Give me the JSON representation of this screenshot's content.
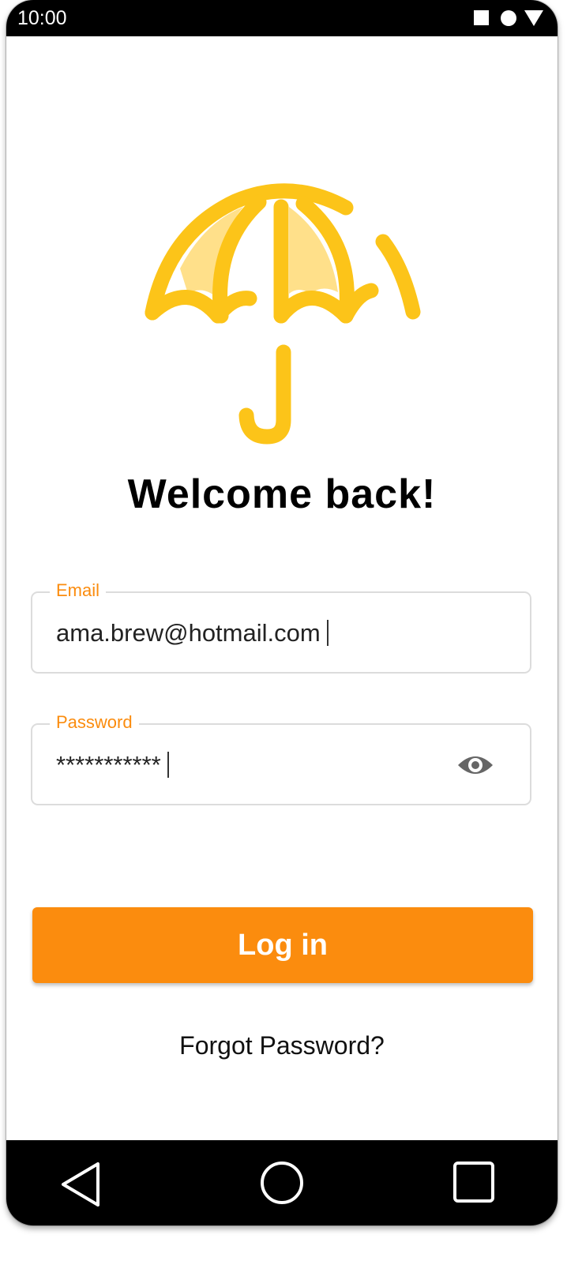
{
  "status_bar": {
    "time": "10:00",
    "icons": [
      "square-icon",
      "circle-icon",
      "triangle-icon"
    ]
  },
  "logo": {
    "icon": "umbrella-icon",
    "colors": {
      "primary": "#fcc419",
      "fill": "#ffe08a"
    }
  },
  "heading": {
    "title": "Welcome back!"
  },
  "form": {
    "email": {
      "label": "Email",
      "value": "ama.brew@hotmail.com"
    },
    "password": {
      "label": "Password",
      "value": "***********",
      "toggle_icon": "eye-icon"
    },
    "login_label": "Log in",
    "forgot_label": "Forgot Password?"
  },
  "nav_bar": {
    "icons": [
      "back-triangle-icon",
      "home-circle-icon",
      "recents-square-icon"
    ]
  },
  "colors": {
    "accent": "#fb8c0e",
    "logo_yellow": "#fcc419",
    "bars": "#000000"
  }
}
